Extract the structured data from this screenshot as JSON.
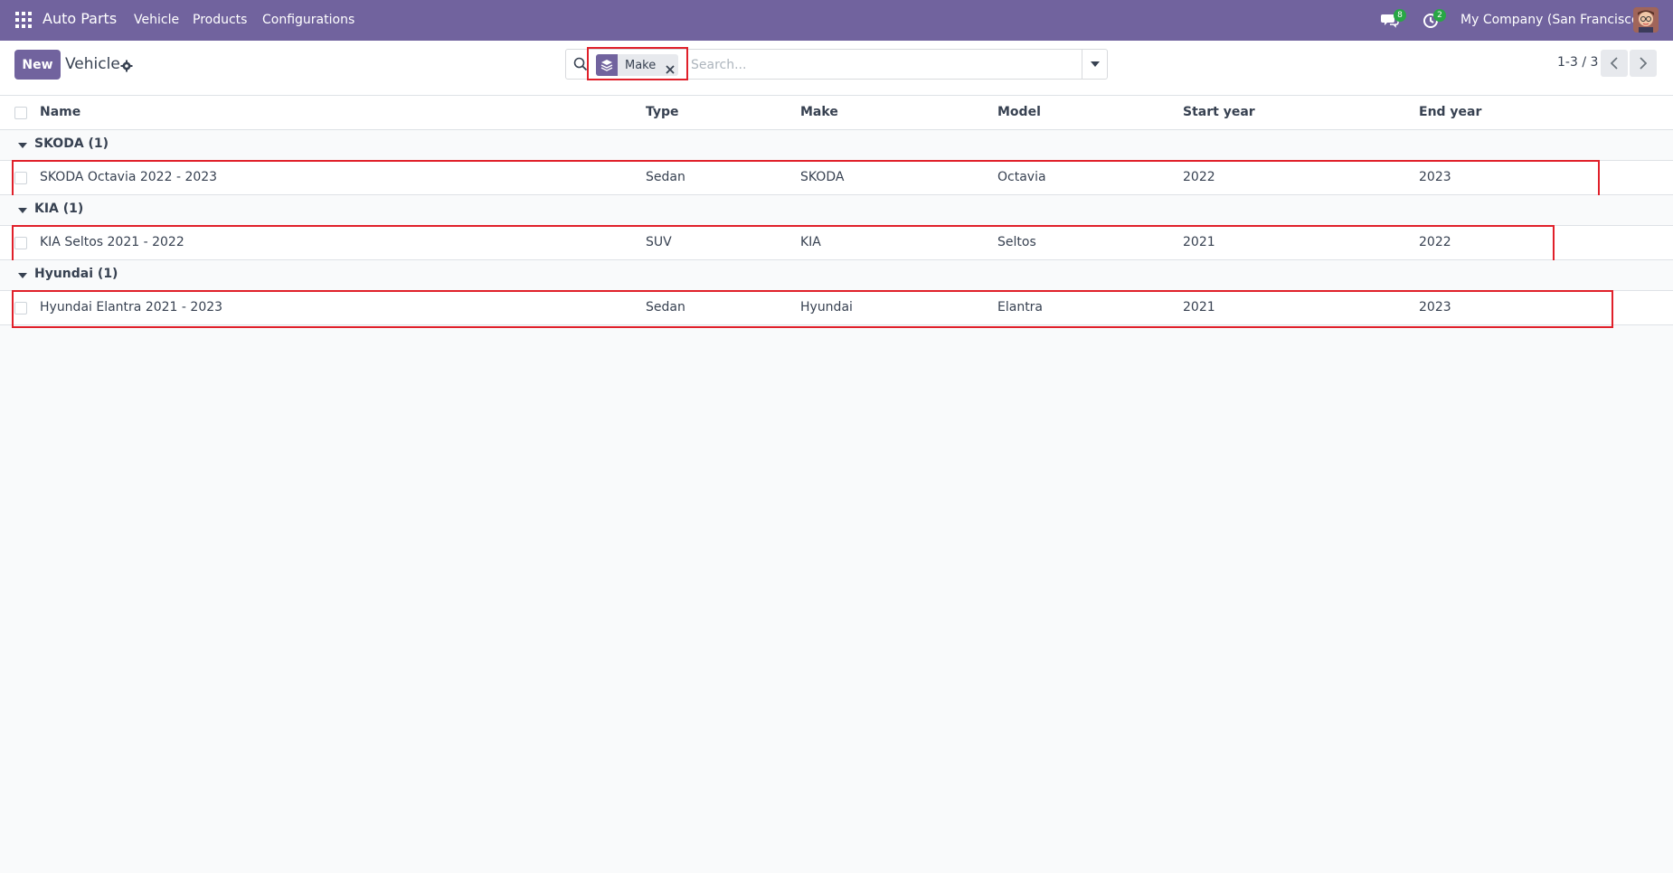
{
  "navbar": {
    "brand": "Auto Parts",
    "menu": [
      "Vehicle",
      "Products",
      "Configurations"
    ],
    "messages_count": "8",
    "activities_count": "2",
    "company": "My Company (San Francisco)"
  },
  "control": {
    "new_label": "New",
    "title": "Vehicle",
    "facet_label": "Make",
    "search_placeholder": "Search...",
    "pager": "1-3 / 3"
  },
  "table": {
    "headers": [
      "Name",
      "Type",
      "Make",
      "Model",
      "Start year",
      "End year"
    ],
    "groups": [
      {
        "label": "SKODA (1)",
        "rows": [
          {
            "name": "SKODA Octavia 2022 - 2023",
            "type": "Sedan",
            "make": "SKODA",
            "model": "Octavia",
            "start_year": "2022",
            "end_year": "2023"
          }
        ]
      },
      {
        "label": "KIA (1)",
        "rows": [
          {
            "name": "KIA Seltos 2021 - 2022",
            "type": "SUV",
            "make": "KIA",
            "model": "Seltos",
            "start_year": "2021",
            "end_year": "2022"
          }
        ]
      },
      {
        "label": "Hyundai (1)",
        "rows": [
          {
            "name": "Hyundai Elantra 2021 - 2023",
            "type": "Sedan",
            "make": "Hyundai",
            "model": "Elantra",
            "start_year": "2021",
            "end_year": "2023"
          }
        ]
      }
    ]
  },
  "colors": {
    "brand": "#71639e",
    "highlight": "#e0202a",
    "badge": "#28a745"
  }
}
